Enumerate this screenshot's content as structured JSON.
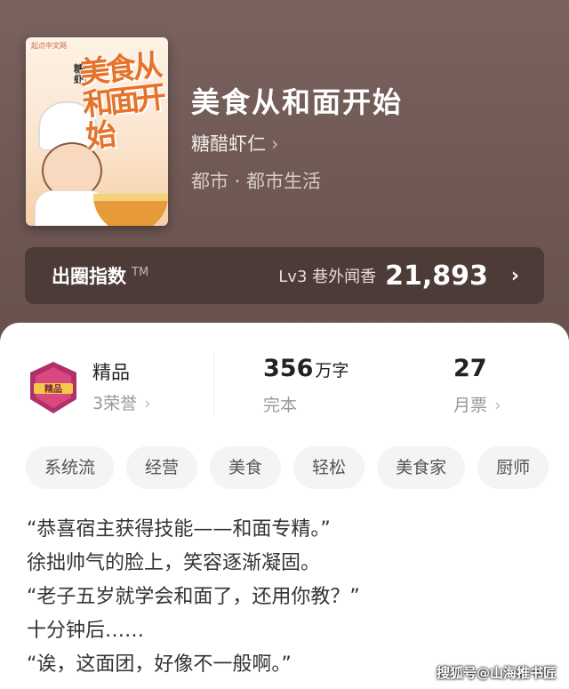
{
  "book": {
    "cover_tag": "起点中文网",
    "cover_title": "美食从和面开始",
    "cover_author": "糖醋虾仁",
    "title": "美食从和面开始",
    "author": "糖醋虾仁",
    "category": "都市 · 都市生活"
  },
  "popularity": {
    "label": "出圈指数",
    "tm": "TM",
    "level": "Lv3 巷外闻香",
    "value": "21,893"
  },
  "stats": {
    "badge_text": "精品",
    "quality_title": "精品",
    "honors": "3荣誉",
    "word_count": "356",
    "word_unit": "万字",
    "status": "完本",
    "monthly_tickets": "27",
    "monthly_label": "月票"
  },
  "tags": [
    "系统流",
    "经营",
    "美食",
    "轻松",
    "美食家",
    "厨师"
  ],
  "excerpt": [
    "“恭喜宿主获得技能——和面专精。”",
    "徐拙帅气的脸上，笑容逐渐凝固。",
    "“老子五岁就学会和面了，还用你教？”",
    "十分钟后……",
    "“诶，这面团，好像不一般啊。”"
  ],
  "watermark": "搜狐号@山海推书匠",
  "colors": {
    "header_bg": "#6b5450",
    "bar_bg": "#4d3b38",
    "cover_title": "#e5732a"
  },
  "icons": {
    "author_chevron": "›",
    "index_chevron": "›",
    "honor_chevron": "›",
    "ticket_chevron": "›"
  }
}
